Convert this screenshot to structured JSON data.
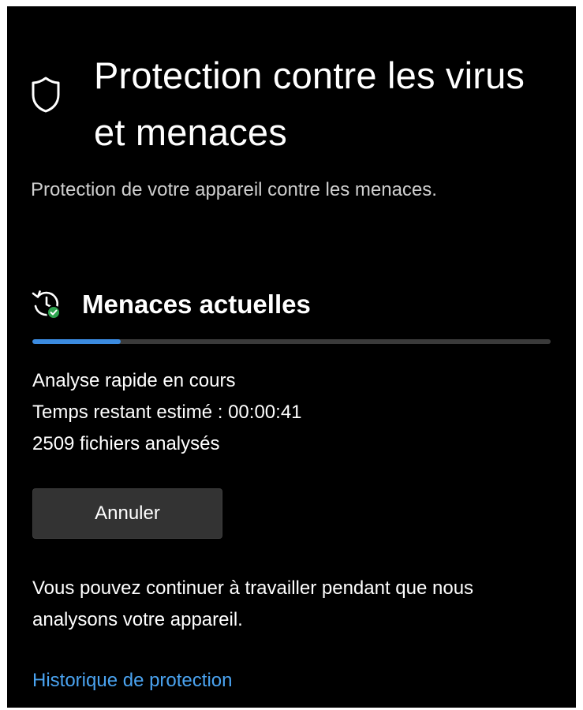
{
  "header": {
    "icon": "shield-icon",
    "title": "Protection contre les virus et menaces",
    "subtitle": "Protection de votre appareil contre les menaces."
  },
  "current_threats": {
    "icon": "clock-refresh-check-icon",
    "title": "Menaces actuelles",
    "progress_fraction": 0.17,
    "status": {
      "scan_label": "Analyse rapide en cours",
      "time_remaining": "Temps restant estimé : 00:00:41",
      "files_scanned": "2509 fichiers analysés"
    },
    "cancel_label": "Annuler",
    "info_text": "Vous pouvez continuer à travailler pendant que nous analysons votre appareil.",
    "history_link": "Historique de protection"
  },
  "colors": {
    "background": "#000000",
    "accent": "#3b8be0",
    "link": "#4aa3f0",
    "check": "#2ea44f"
  }
}
